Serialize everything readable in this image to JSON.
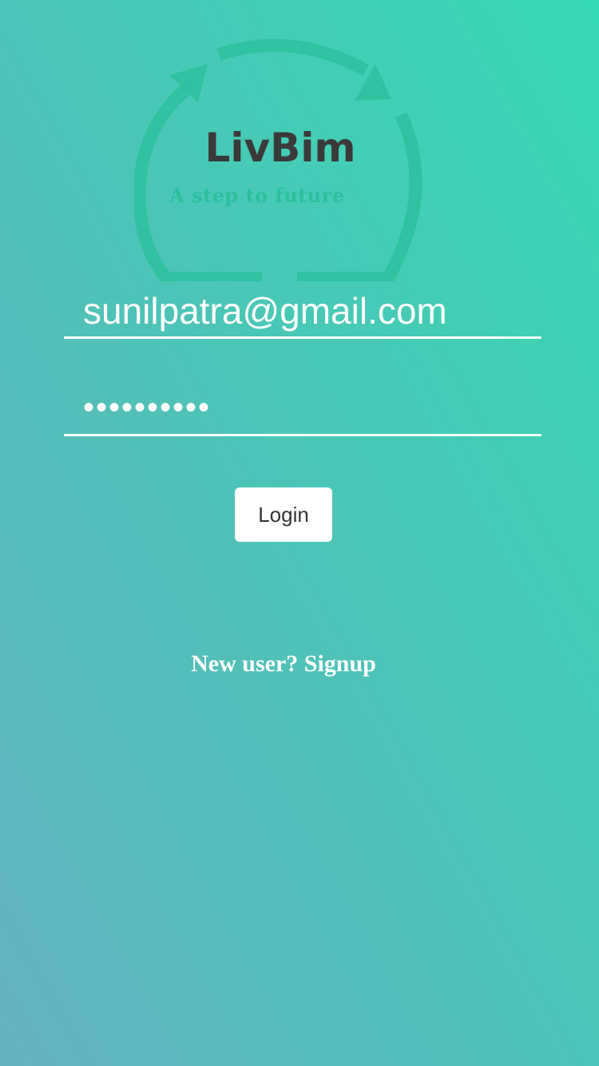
{
  "logo": {
    "title": "LivBim",
    "tagline": "A  step to future"
  },
  "login_form": {
    "email_value": "sunilpatra@gmail.com",
    "password_value": "sunilpatra",
    "login_label": "Login"
  },
  "signup": {
    "link_text": "New user? Signup"
  },
  "colors": {
    "background_top_right": "#36d9b2",
    "background_bottom_left": "#65b2c0",
    "logo_ring": "#2bbf9c",
    "logo_title": "#3a3a3a",
    "field_underline": "#ffffff",
    "button_background": "#ffffff",
    "button_text": "#333333"
  }
}
